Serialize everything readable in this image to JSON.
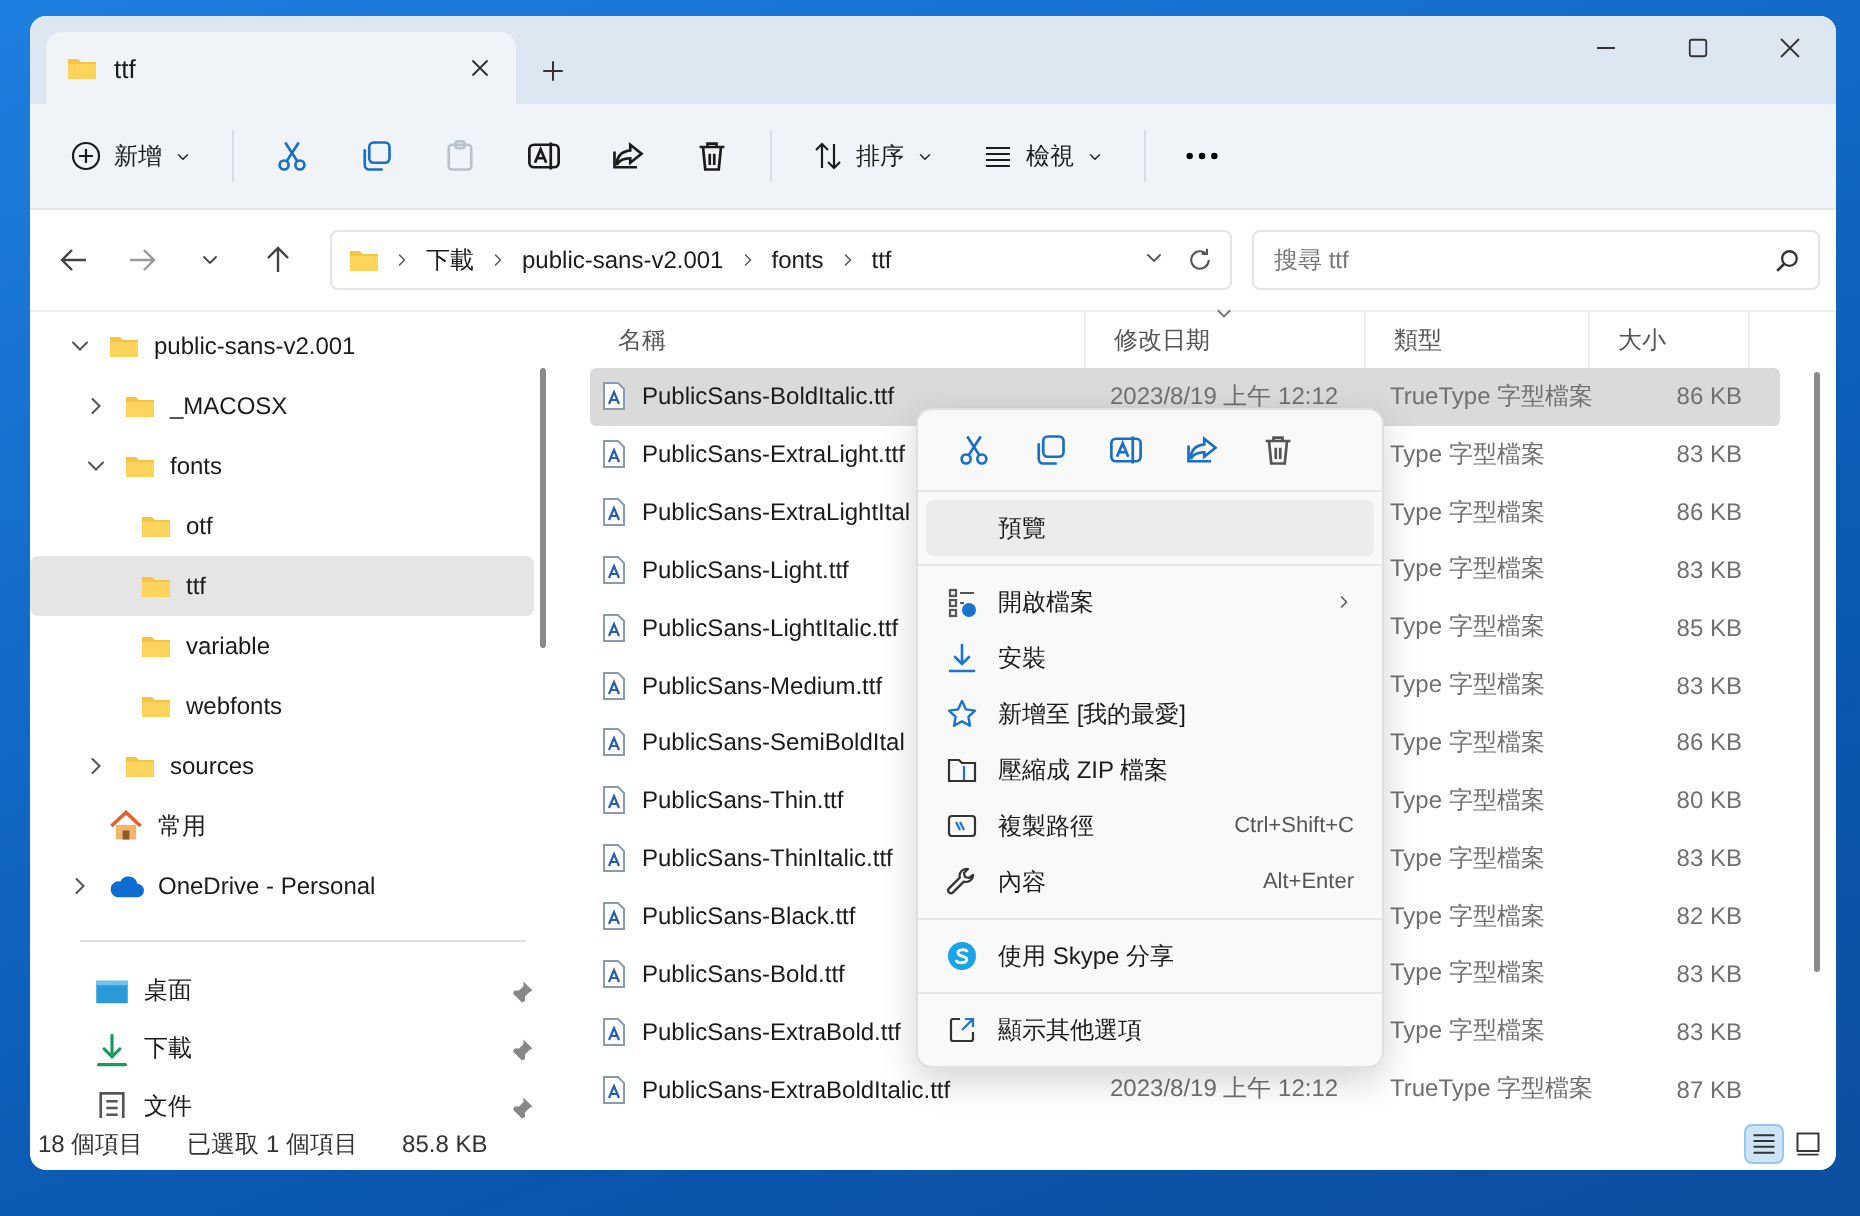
{
  "window": {
    "tab": {
      "title": "ttf"
    }
  },
  "toolbar": {
    "new_label": "新增",
    "icon_buttons": [
      {
        "disabled": false
      },
      {
        "disabled": false
      },
      {
        "disabled": true
      },
      {
        "disabled": false
      },
      {
        "disabled": false
      },
      {
        "disabled": false
      }
    ],
    "sort_label": "排序",
    "view_label": "檢視"
  },
  "address_bar": {
    "breadcrumb": [
      "下載",
      "public-sans-v2.001",
      "fonts",
      "ttf"
    ],
    "search": {
      "placeholder": "搜尋 ttf"
    }
  },
  "sidebar": {
    "tree": [
      {
        "label": "public-sans-v2.001",
        "kind": "folder",
        "expandable": true,
        "expanded": true,
        "selected": false,
        "children": [
          {
            "label": "_MACOSX",
            "kind": "folder",
            "expandable": true,
            "expanded": false,
            "selected": false
          },
          {
            "label": "fonts",
            "kind": "folder",
            "expandable": true,
            "expanded": true,
            "selected": false,
            "children": [
              {
                "label": "otf",
                "kind": "folder",
                "expandable": false,
                "expanded": false,
                "selected": false
              },
              {
                "label": "ttf",
                "kind": "folder",
                "expandable": false,
                "expanded": false,
                "selected": true
              },
              {
                "label": "variable",
                "kind": "folder",
                "expandable": false,
                "expanded": false,
                "selected": false
              },
              {
                "label": "webfonts",
                "kind": "folder",
                "expandable": false,
                "expanded": false,
                "selected": false
              }
            ]
          },
          {
            "label": "sources",
            "kind": "folder",
            "expandable": true,
            "expanded": false,
            "selected": false
          }
        ]
      },
      {
        "label": "常用",
        "kind": "home",
        "expandable": false,
        "expanded": false,
        "selected": false
      },
      {
        "label": "OneDrive - Personal",
        "kind": "cloud",
        "expandable": true,
        "expanded": false,
        "selected": false
      }
    ],
    "pinned": [
      {
        "label": "桌面",
        "kind": "desktop",
        "pinned": true
      },
      {
        "label": "下載",
        "kind": "download",
        "pinned": true
      },
      {
        "label": "文件",
        "kind": "document",
        "pinned": true
      }
    ]
  },
  "file_list": {
    "columns": [
      {
        "label": "名稱",
        "sorted": false
      },
      {
        "label": "修改日期",
        "sorted": true
      },
      {
        "label": "類型",
        "sorted": false
      },
      {
        "label": "大小",
        "sorted": false
      }
    ],
    "rows": [
      {
        "name": "PublicSans-BoldItalic.ttf",
        "date": "2023/8/19 上午 12:12",
        "type": "TrueType 字型檔案",
        "size": "86 KB",
        "selected": true
      },
      {
        "name": "PublicSans-ExtraLight.ttf",
        "type": "Type 字型檔案",
        "size": "83 KB",
        "selected": false
      },
      {
        "name": "PublicSans-ExtraLightItal",
        "type": "Type 字型檔案",
        "size": "86 KB",
        "selected": false
      },
      {
        "name": "PublicSans-Light.ttf",
        "type": "Type 字型檔案",
        "size": "83 KB",
        "selected": false
      },
      {
        "name": "PublicSans-LightItalic.ttf",
        "type": "Type 字型檔案",
        "size": "85 KB",
        "selected": false
      },
      {
        "name": "PublicSans-Medium.ttf",
        "type": "Type 字型檔案",
        "size": "83 KB",
        "selected": false
      },
      {
        "name": "PublicSans-SemiBoldItal",
        "type": "Type 字型檔案",
        "size": "86 KB",
        "selected": false
      },
      {
        "name": "PublicSans-Thin.ttf",
        "type": "Type 字型檔案",
        "size": "80 KB",
        "selected": false
      },
      {
        "name": "PublicSans-ThinItalic.ttf",
        "type": "Type 字型檔案",
        "size": "83 KB",
        "selected": false
      },
      {
        "name": "PublicSans-Black.ttf",
        "type": "Type 字型檔案",
        "size": "82 KB",
        "selected": false
      },
      {
        "name": "PublicSans-Bold.ttf",
        "type": "Type 字型檔案",
        "size": "83 KB",
        "selected": false
      },
      {
        "name": "PublicSans-ExtraBold.ttf",
        "type": "Type 字型檔案",
        "size": "83 KB",
        "selected": false
      },
      {
        "name": "PublicSans-ExtraBoldItalic.ttf",
        "date": "2023/8/19 上午 12:12",
        "type": "TrueType 字型檔案",
        "size": "87 KB",
        "selected": false
      }
    ]
  },
  "context_menu": {
    "groups": [
      [
        {
          "label": "預覽",
          "kind": "preview",
          "selected": true
        }
      ],
      [
        {
          "label": "開啟檔案",
          "kind": "open",
          "submenu": true,
          "selected": false
        },
        {
          "label": "安裝",
          "kind": "install",
          "selected": false
        },
        {
          "label": "新增至 [我的最愛]",
          "kind": "favorite",
          "selected": false
        },
        {
          "label": "壓縮成 ZIP 檔案",
          "kind": "zip",
          "selected": false
        },
        {
          "label": "複製路徑",
          "kind": "path",
          "shortcut": "Ctrl+Shift+C",
          "selected": false
        },
        {
          "label": "內容",
          "kind": "properties",
          "shortcut": "Alt+Enter",
          "selected": false
        }
      ],
      [
        {
          "label": "使用 Skype 分享",
          "kind": "skype",
          "selected": false
        }
      ],
      [
        {
          "label": "顯示其他選項",
          "kind": "more",
          "selected": false
        }
      ]
    ]
  },
  "status_bar": {
    "item_count": "18 個項目",
    "selection": "已選取 1 個項目",
    "selection_size": "85.8 KB",
    "views": [
      {
        "kind": "details",
        "selected": true
      },
      {
        "kind": "tiles",
        "selected": false
      }
    ]
  }
}
